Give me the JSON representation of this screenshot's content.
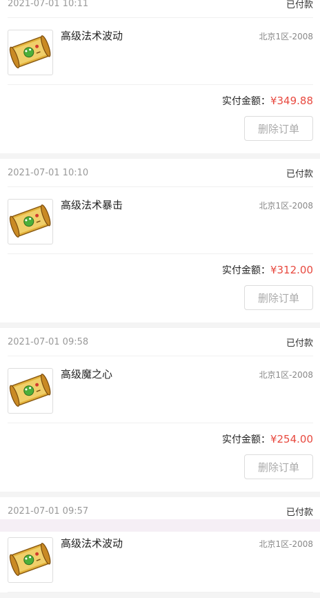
{
  "orders": [
    {
      "time": "2021-07-01 10:11",
      "status": "已付款",
      "item_name": "高级法术波动",
      "server": "北京1区-2008",
      "pay_label": "实付金额：",
      "amount": "¥349.88",
      "delete_label": "删除订单"
    },
    {
      "time": "2021-07-01 10:10",
      "status": "已付款",
      "item_name": "高级法术暴击",
      "server": "北京1区-2008",
      "pay_label": "实付金额：",
      "amount": "¥312.00",
      "delete_label": "删除订单"
    },
    {
      "time": "2021-07-01 09:58",
      "status": "已付款",
      "item_name": "高级魔之心",
      "server": "北京1区-2008",
      "pay_label": "实付金额：",
      "amount": "¥254.00",
      "delete_label": "删除订单"
    },
    {
      "time": "2021-07-01 09:57",
      "status": "已付款",
      "item_name": "高级法术波动",
      "server": "北京1区-2008"
    }
  ],
  "icons": {
    "item": "scroll-icon"
  },
  "colors": {
    "amount": "#e8493f",
    "background": "#f4f4f4"
  }
}
